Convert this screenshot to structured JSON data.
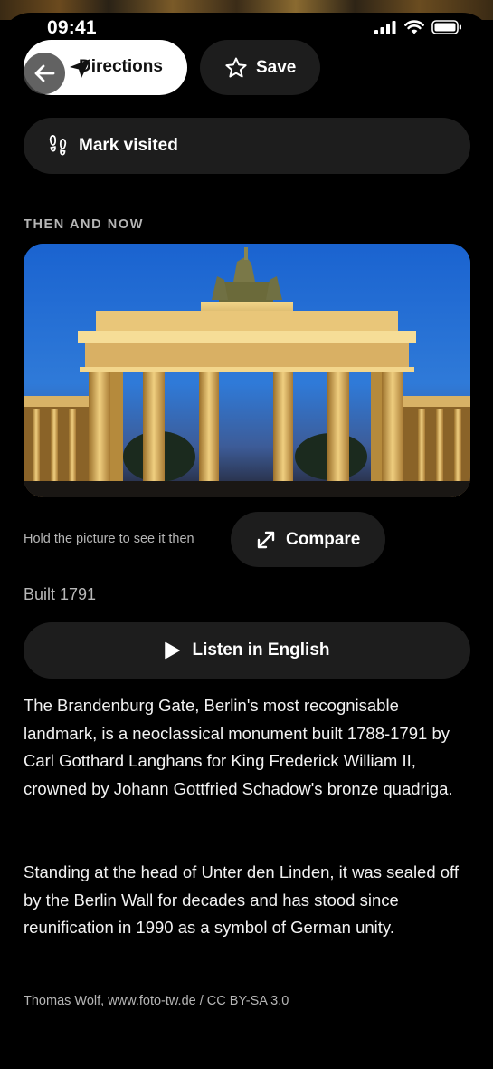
{
  "status_bar": {
    "time": "09:41"
  },
  "actions": {
    "directions_label": "Directions",
    "save_label": "Save",
    "mark_visited_label": "Mark visited"
  },
  "then_and_now": {
    "section_label": "THEN AND NOW",
    "hint": "Hold the picture to see it then",
    "compare_label": "Compare"
  },
  "details": {
    "built": "Built 1791",
    "listen_label": "Listen in English",
    "paragraphs": [
      "The Brandenburg Gate, Berlin's most recognisable landmark, is a neoclassical monument built 1788-1791 by Carl Gotthard Langhans for King Frederick William II, crowned by Johann Gottfried Schadow's bronze quadriga.",
      "Standing at the head of Unter den Linden, it was sealed off by the Berlin Wall for decades and has stood since reunification in 1990 as a symbol of German unity."
    ],
    "credit": "Thomas Wolf, www.foto-tw.de / CC BY-SA 3.0"
  },
  "icons": {
    "back": "arrow-left-icon",
    "directions": "navigation-arrow-icon",
    "save": "star-icon",
    "mark_visited": "footprints-icon",
    "compare": "expand-arrows-icon",
    "listen": "play-icon"
  },
  "colors": {
    "background": "#000000",
    "pill_dark": "#1d1d1d",
    "pill_light": "#ffffff",
    "muted_text": "#b5b5b5"
  }
}
